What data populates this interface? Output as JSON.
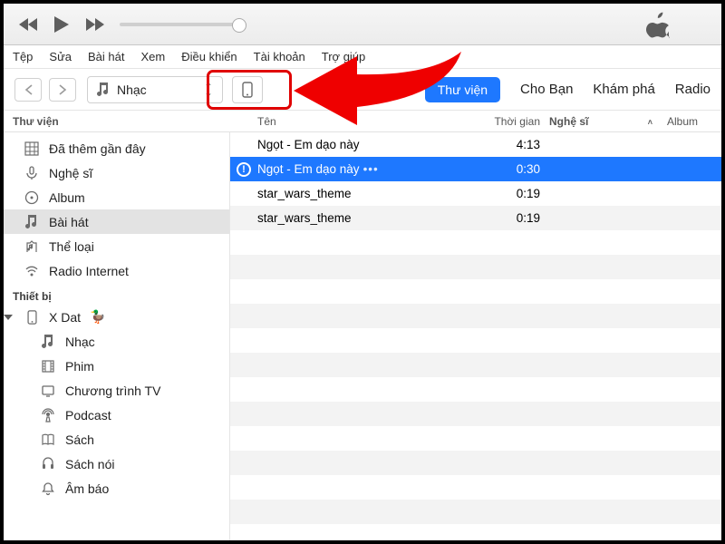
{
  "menubar": [
    "Tệp",
    "Sửa",
    "Bài hát",
    "Xem",
    "Điều khiển",
    "Tài khoản",
    "Trợ giúp"
  ],
  "picker": {
    "label": "Nhạc"
  },
  "tabs": {
    "primary": "Thư viện",
    "items": [
      "Cho Bạn",
      "Khám phá",
      "Radio"
    ]
  },
  "columns": {
    "sidebar": "Thư viện",
    "name": "Tên",
    "time": "Thời gian",
    "artist": "Nghệ sĩ",
    "album": "Album"
  },
  "sidebar": {
    "library_header": "Thư viện",
    "library_items": [
      {
        "label": "Đã thêm gần đây",
        "icon": "grid"
      },
      {
        "label": "Nghệ sĩ",
        "icon": "mic"
      },
      {
        "label": "Album",
        "icon": "disc"
      },
      {
        "label": "Bài hát",
        "icon": "note",
        "selected": true
      },
      {
        "label": "Thể loại",
        "icon": "genre"
      },
      {
        "label": "Radio Internet",
        "icon": "radio"
      }
    ],
    "devices_header": "Thiết bị",
    "device": {
      "name": "X Dat",
      "emoji": "🦆"
    },
    "device_items": [
      {
        "label": "Nhạc",
        "icon": "note"
      },
      {
        "label": "Phim",
        "icon": "film"
      },
      {
        "label": "Chương trình TV",
        "icon": "tv"
      },
      {
        "label": "Podcast",
        "icon": "podcast"
      },
      {
        "label": "Sách",
        "icon": "book"
      },
      {
        "label": "Sách nói",
        "icon": "audiobook"
      },
      {
        "label": "Âm báo",
        "icon": "bell"
      }
    ]
  },
  "tracks": [
    {
      "name": "Ngọt - Em dạo này",
      "time": "4:13"
    },
    {
      "name": "Ngọt - Em dạo này",
      "time": "0:30",
      "selected": true,
      "badge": "!"
    },
    {
      "name": "star_wars_theme",
      "time": "0:19"
    },
    {
      "name": "star_wars_theme",
      "time": "0:19"
    }
  ]
}
